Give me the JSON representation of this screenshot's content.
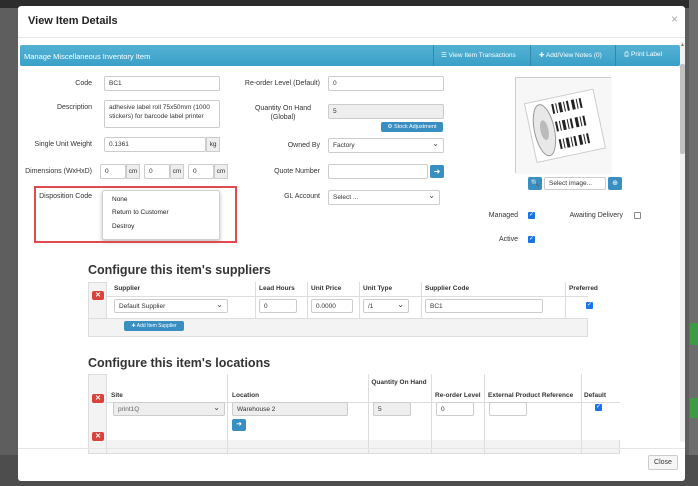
{
  "modal": {
    "title": "View Item Details",
    "close_glyph": "×",
    "close_button": "Close"
  },
  "bar": {
    "title": "Manage Miscellaneous Inventory Item",
    "view_transactions": "View Item Transactions",
    "add_notes": "Add/View Notes (0)",
    "print_label": "Print Label"
  },
  "form": {
    "code_label": "Code",
    "code_value": "BC1",
    "description_label": "Description",
    "description_value": "adhesive label roll 75x50mm (1000 stickers)  for barcode label printer",
    "weight_label": "Single Unit Weight",
    "weight_value": "0.1361",
    "weight_unit": "kg",
    "dimensions_label": "Dimensions (WxHxD)",
    "dim_w": "0",
    "dim_h": "0",
    "dim_d": "0",
    "dim_unit": "cm",
    "disposition_label": "Disposition Code",
    "disposition_options": [
      "None",
      "Return to Customer",
      "Destroy"
    ],
    "reorder_label": "Re-order Level (Default)",
    "reorder_value": "0",
    "qoh_label": "Quantity On Hand (Global)",
    "qoh_value": "5",
    "stock_adjust": "Stock Adjustment",
    "owned_label": "Owned By",
    "owned_value": "Factory",
    "quote_label": "Quote Number",
    "quote_value": "",
    "gl_label": "GL Account",
    "gl_value": "Select ...",
    "managed_label": "Managed",
    "awaiting_label": "Awaiting Delivery",
    "active_label": "Active",
    "image_select": "Select image...",
    "managed": true,
    "awaiting": false,
    "active": true
  },
  "suppliers": {
    "heading": "Configure this item's suppliers",
    "columns": [
      "Supplier",
      "Lead Hours",
      "Unit Price",
      "Unit Type",
      "Supplier Code",
      "Preferred"
    ],
    "row": {
      "supplier": "Default Supplier",
      "lead_hours": "0",
      "unit_price": "0.0000",
      "unit_type": "/1",
      "supplier_code": "BC1",
      "preferred": true
    },
    "add_button": "Add Item Supplier"
  },
  "locations": {
    "heading": "Configure this item's locations",
    "columns": [
      "Site",
      "Location",
      "Quantity On Hand",
      "Re-order Level",
      "External Product Reference",
      "Default"
    ],
    "row": {
      "site": "print1Q",
      "location": "Warehouse 2",
      "qoh": "5",
      "reorder": "0",
      "external_ref": "",
      "default": true
    }
  },
  "colors": {
    "accent": "#3a9fc6",
    "danger": "#d9433b",
    "highlight": "#e24b4b"
  },
  "icons": [
    "list-icon",
    "plus-icon",
    "print-icon",
    "search-icon",
    "upload-icon",
    "arrow-right-icon",
    "remove-icon",
    "adjust-icon"
  ]
}
